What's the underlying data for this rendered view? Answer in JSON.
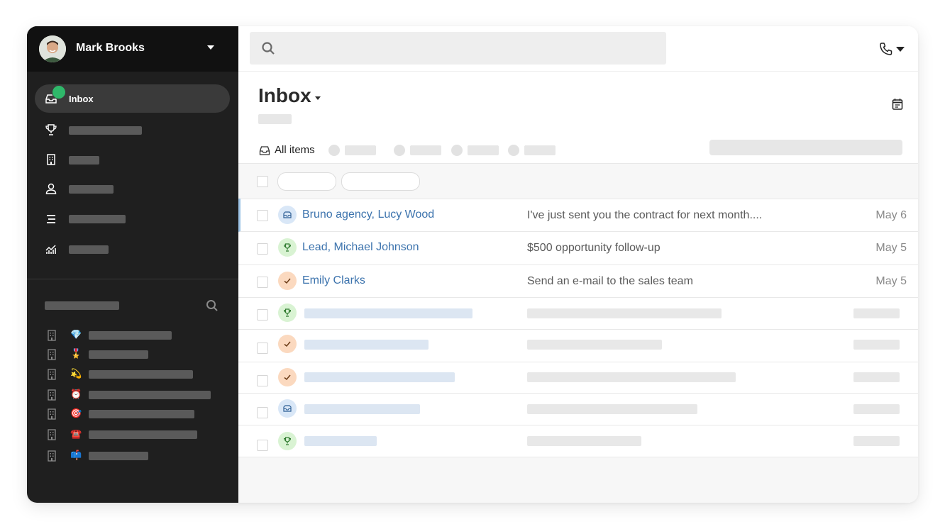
{
  "user": {
    "name": "Mark Brooks"
  },
  "nav": {
    "items": [
      {
        "id": "inbox",
        "label": "Inbox",
        "icon": "inbox-icon",
        "active": true,
        "has_notification": true
      },
      {
        "id": "deals",
        "label": "",
        "icon": "trophy-icon"
      },
      {
        "id": "companies",
        "label": "",
        "icon": "building-icon"
      },
      {
        "id": "people",
        "label": "",
        "icon": "person-icon"
      },
      {
        "id": "lists",
        "label": "",
        "icon": "list-icon"
      },
      {
        "id": "reports",
        "label": "",
        "icon": "chart-icon"
      }
    ]
  },
  "saved_lists": {
    "items": [
      {
        "emoji": "💎"
      },
      {
        "emoji": "🎖️"
      },
      {
        "emoji": "💫"
      },
      {
        "emoji": "⏰"
      },
      {
        "emoji": "🎯"
      },
      {
        "emoji": "☎️"
      },
      {
        "emoji": "📫"
      }
    ]
  },
  "search": {
    "placeholder": ""
  },
  "header": {
    "title": "Inbox"
  },
  "tabs": {
    "active_label": "All items"
  },
  "messages": [
    {
      "contact": "Bruno agency, Lucy Wood",
      "subject": "I've just sent you the contract for next month....",
      "date": "May 6",
      "type": "mail",
      "selected": true
    },
    {
      "contact": "Lead, Michael Johnson",
      "subject": "$500 opportunity follow-up",
      "date": "May 5",
      "type": "trophy"
    },
    {
      "contact": "Emily Clarks",
      "subject": "Send an e-mail to the sales team",
      "date": "May 5",
      "type": "check"
    },
    {
      "contact": "",
      "subject": "",
      "date": "",
      "type": "trophy"
    },
    {
      "contact": "",
      "subject": "",
      "date": "",
      "type": "check"
    },
    {
      "contact": "",
      "subject": "",
      "date": "",
      "type": "check"
    },
    {
      "contact": "",
      "subject": "",
      "date": "",
      "type": "mail"
    },
    {
      "contact": "",
      "subject": "",
      "date": "",
      "type": "trophy"
    }
  ],
  "colors": {
    "sidebar_bg": "#1f1f1f",
    "user_bar_bg": "#111111",
    "active_nav_bg": "#3a3a3a",
    "notification_badge": "#2fb86a",
    "link_blue": "#3c73ad",
    "mail_badge": "#d9e7f7",
    "trophy_badge": "#d9f3d3",
    "check_badge": "#fbd9bf"
  }
}
